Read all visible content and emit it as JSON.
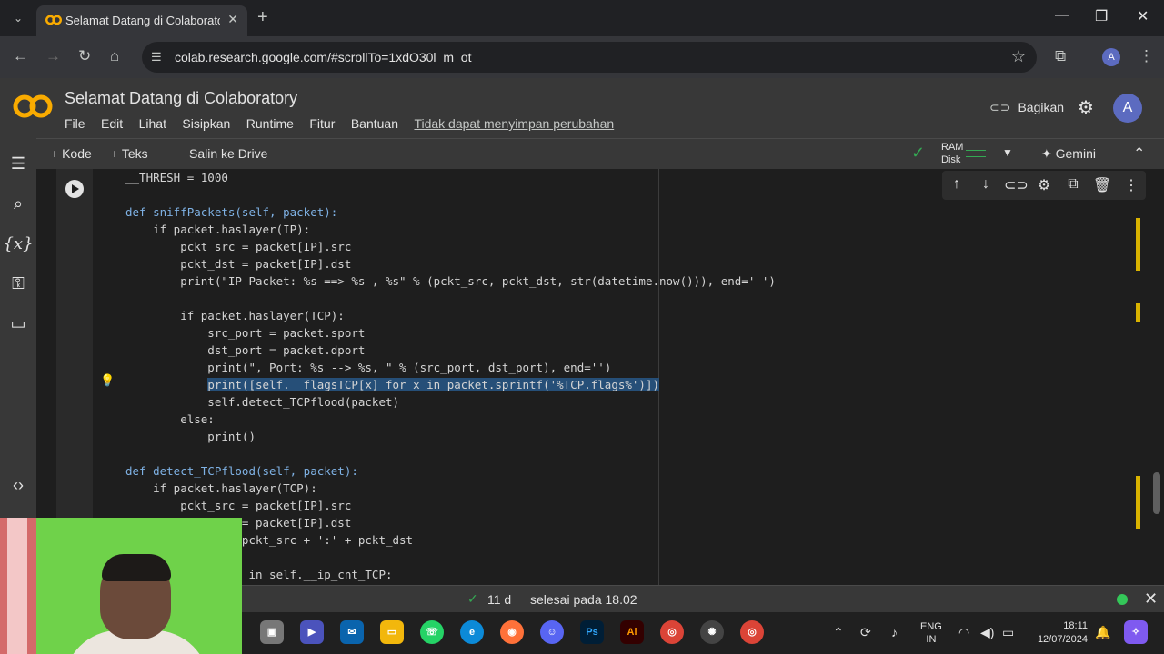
{
  "browser": {
    "tab_title": "Selamat Datang di Colaboratory",
    "url": "colab.research.google.com/#scrollTo=1xdO30l_m_ot",
    "profile_initial": "A"
  },
  "colab": {
    "title": "Selamat Datang di Colaboratory",
    "menu": [
      "File",
      "Edit",
      "Lihat",
      "Sisipkan",
      "Runtime",
      "Fitur",
      "Bantuan"
    ],
    "unsaved_notice": "Tidak dapat menyimpan perubahan",
    "share_label": "Bagikan",
    "avatar_initial": "A"
  },
  "toolbar": {
    "add_code": "+ Kode",
    "add_text": "+ Teks",
    "copy_to_drive": "Salin ke Drive",
    "ram_label": "RAM",
    "disk_label": "Disk",
    "gemini_label": "Gemini"
  },
  "code_lines": [
    "__THRESH = 1000",
    "",
    "def sniffPackets(self, packet):",
    "    if packet.haslayer(IP):",
    "        pckt_src = packet[IP].src",
    "        pckt_dst = packet[IP].dst",
    "        print(\"IP Packet: %s ==> %s , %s\" % (pckt_src, pckt_dst, str(datetime.now())), end=' ')",
    "",
    "        if packet.haslayer(TCP):",
    "            src_port = packet.sport",
    "            dst_port = packet.dport",
    "            print(\", Port: %s --> %s, \" % (src_port, dst_port), end='')",
    "            print([self.__flagsTCP[x] for x in packet.sprintf('%TCP.flags%')])",
    "            self.detect_TCPflood(packet)",
    "        else:",
    "            print()",
    "",
    "def detect_TCPflood(self, packet):",
    "    if packet.haslayer(TCP):",
    "        pckt_src = packet[IP].src",
    "        pckt_dst = packet[IP].dst",
    "        stream = pckt_src + ':' + pckt_dst",
    "",
    "        if stream in self.__ip_cnt_TCP:"
  ],
  "highlighted_line_index": 12,
  "status": {
    "elapsed": "11 d",
    "completed": "selesai pada 18.02"
  },
  "taskbar": {
    "lang_top": "ENG",
    "lang_bottom": "IN",
    "time": "18:11",
    "date": "12/07/2024"
  }
}
